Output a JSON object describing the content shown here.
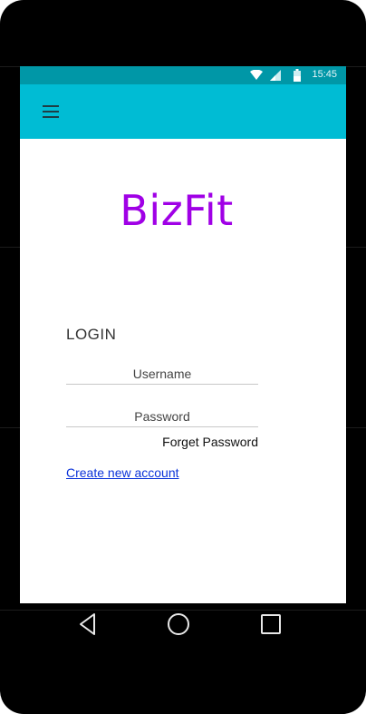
{
  "status_bar": {
    "time": "15:45",
    "icons": [
      "wifi-icon",
      "signal-icon",
      "battery-icon"
    ]
  },
  "app_bar": {
    "menu_icon": "hamburger-menu-icon",
    "color": "#00bcd4",
    "status_color": "#0097a7"
  },
  "brand": {
    "text": "BizFit",
    "color": "#a000e6"
  },
  "login": {
    "title": "LOGIN",
    "username_placeholder": "Username",
    "password_placeholder": "Password",
    "forget_label": "Forget Password",
    "create_label": "Create new account"
  },
  "nav_bar": {
    "icons": [
      "back-icon",
      "home-icon",
      "recents-icon"
    ]
  }
}
